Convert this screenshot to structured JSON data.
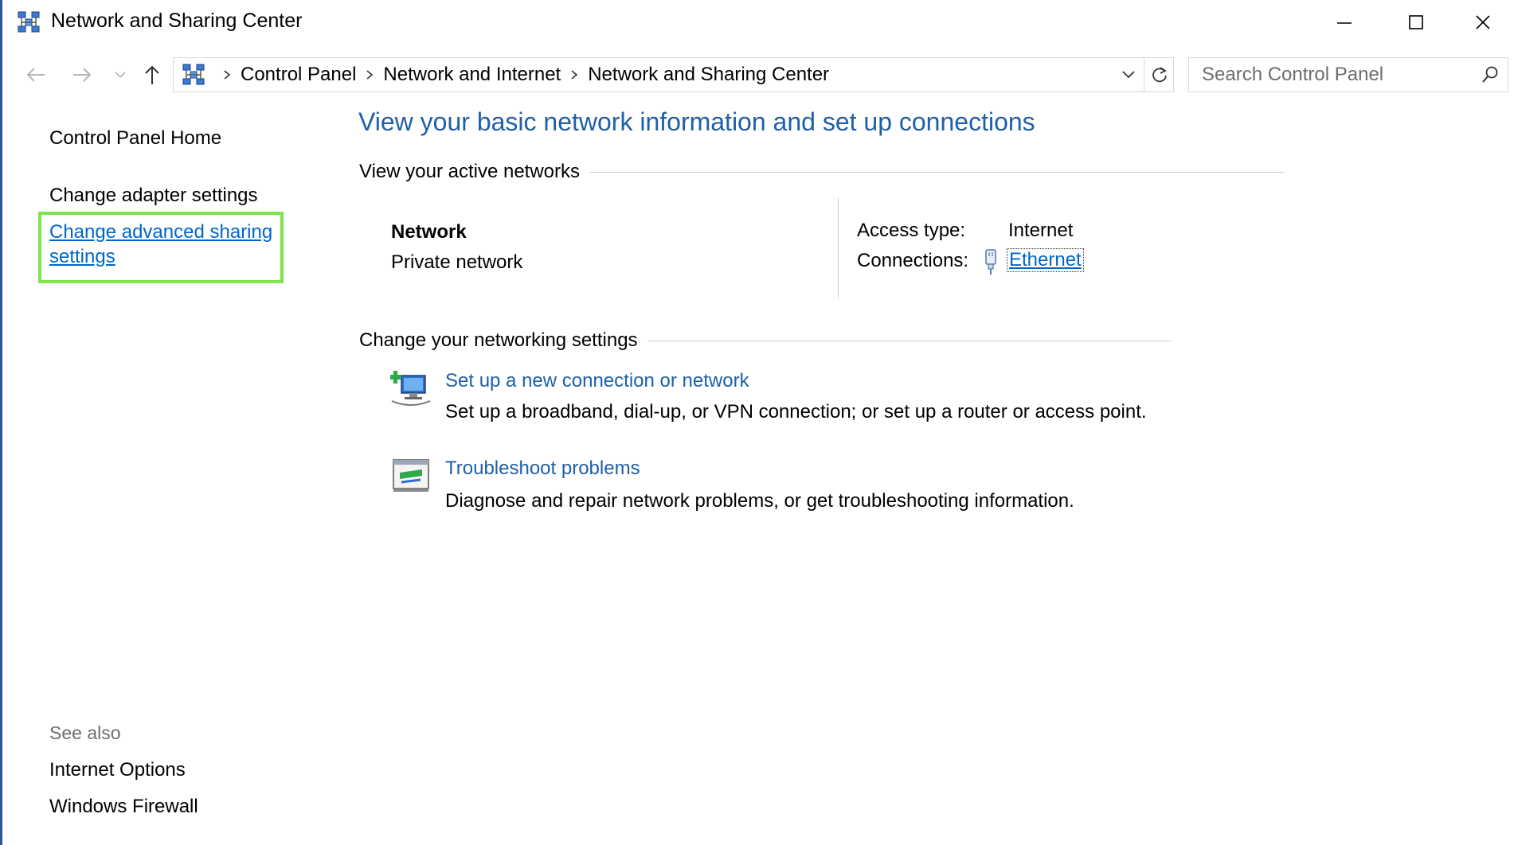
{
  "window": {
    "title": "Network and Sharing Center"
  },
  "address_bar": {
    "breadcrumbs": [
      "Control Panel",
      "Network and Internet",
      "Network and Sharing Center"
    ]
  },
  "search": {
    "placeholder": "Search Control Panel"
  },
  "left_pane": {
    "home_link": "Control Panel Home",
    "adapter_link": "Change adapter settings",
    "advanced_link": "Change advanced sharing settings",
    "see_also_label": "See also",
    "see_also_links": [
      "Internet Options",
      "Windows Firewall"
    ]
  },
  "main": {
    "title": "View your basic network information and set up connections",
    "active_networks_heading": "View your active networks",
    "network": {
      "name": "Network",
      "type": "Private network",
      "access_type_label": "Access type:",
      "access_type_value": "Internet",
      "connections_label": "Connections:",
      "connections_value": "Ethernet"
    },
    "change_settings_heading": "Change your networking settings",
    "tasks": [
      {
        "icon": "new-connection-icon",
        "link": "Set up a new connection or network",
        "description": "Set up a broadband, dial-up, or VPN connection; or set up a router or access point."
      },
      {
        "icon": "troubleshoot-icon",
        "link": "Troubleshoot problems",
        "description": "Diagnose and repair network problems, or get troubleshooting information."
      }
    ]
  },
  "colors": {
    "link_blue": "#0066cc",
    "heading_blue": "#1e5faa",
    "highlight_green": "#7fe34a",
    "window_border": "#2b579a"
  }
}
